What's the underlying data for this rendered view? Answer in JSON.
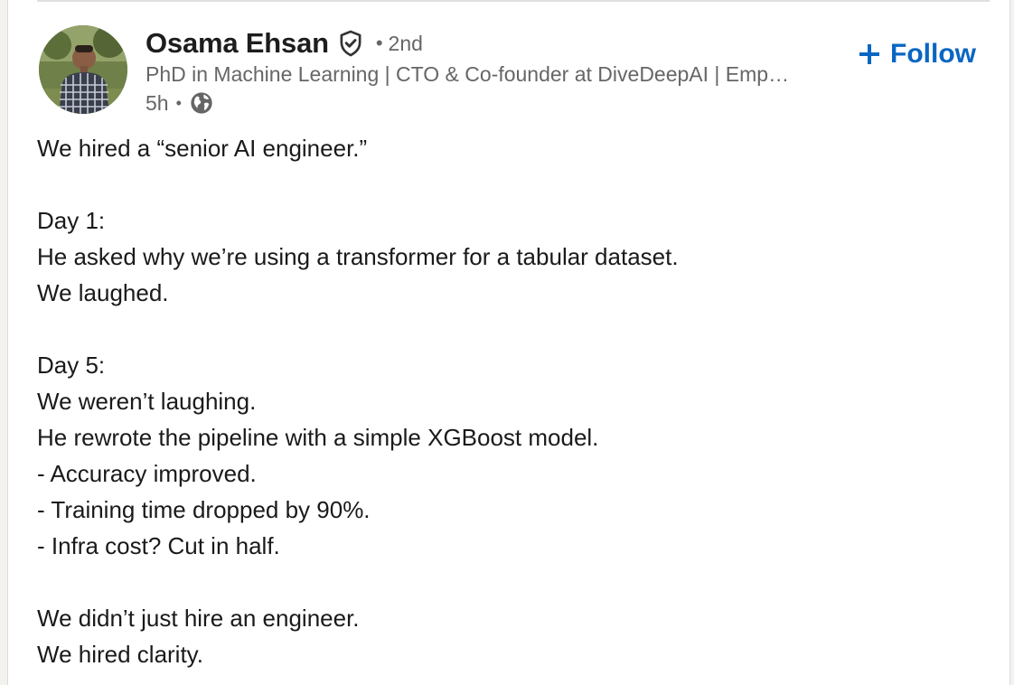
{
  "post": {
    "author": {
      "name": "Osama Ehsan",
      "degree": "2nd",
      "headline": "PhD in Machine Learning | CTO & Co-founder at DiveDeepAI | Emp…",
      "time": "5h"
    },
    "follow_label": "Follow",
    "lines": [
      "We hired a “senior AI engineer.”",
      "",
      "Day 1:",
      "He asked why we’re using a transformer for a tabular dataset.",
      "We laughed.",
      "",
      "Day 5:",
      "We weren’t laughing.",
      "He rewrote the pipeline with a simple XGBoost model.",
      "- Accuracy improved.",
      "- Training time dropped by 90%.",
      "- Infra cost? Cut in half.",
      "",
      "We didn’t just hire an engineer.",
      "We hired clarity."
    ]
  },
  "icons": {
    "verified": "verified-badge-icon",
    "visibility": "globe-icon",
    "follow": "plus-icon"
  },
  "colors": {
    "accent": "#0a66c2",
    "text_primary": "#1a1a1a",
    "text_secondary": "#666666"
  }
}
